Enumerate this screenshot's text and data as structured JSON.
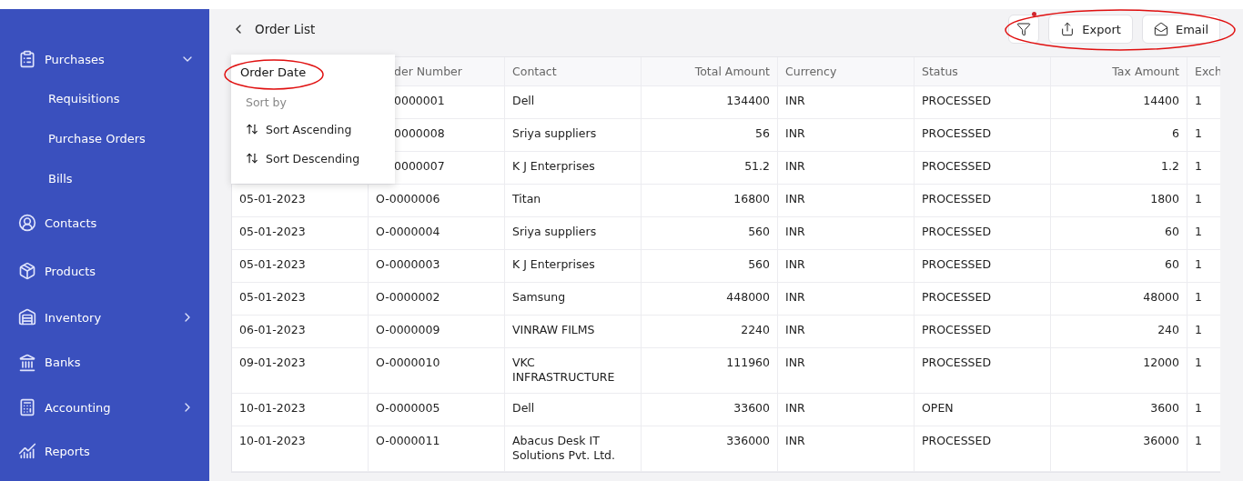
{
  "sidebar": {
    "items": [
      {
        "label": "Purchases",
        "expanded": true,
        "children": [
          {
            "label": "Requisitions"
          },
          {
            "label": "Purchase Orders"
          },
          {
            "label": "Bills"
          }
        ]
      },
      {
        "label": "Contacts"
      },
      {
        "label": "Products"
      },
      {
        "label": "Inventory",
        "expanded": false
      },
      {
        "label": "Banks"
      },
      {
        "label": "Accounting",
        "expanded": false
      },
      {
        "label": "Reports"
      }
    ]
  },
  "header": {
    "title": "Order List",
    "filter": {
      "indicator": true
    },
    "buttons": [
      {
        "label": "Export"
      },
      {
        "label": "Email"
      }
    ]
  },
  "table": {
    "columns": [
      null,
      "der Number",
      "Contact",
      "Total Amount",
      "Currency",
      "Status",
      "Tax Amount",
      "Exch"
    ],
    "rows": [
      [
        null,
        "0000001",
        "Dell",
        "134400",
        "INR",
        "PROCESSED",
        "14400",
        "1"
      ],
      [
        null,
        "0000008",
        "Sriya suppliers",
        "56",
        "INR",
        "PROCESSED",
        "6",
        "1"
      ],
      [
        null,
        "0000007",
        "K J Enterprises",
        "51.2",
        "INR",
        "PROCESSED",
        "1.2",
        "1"
      ],
      [
        "05-01-2023",
        "O-0000006",
        "Titan",
        "16800",
        "INR",
        "PROCESSED",
        "1800",
        "1"
      ],
      [
        "05-01-2023",
        "O-0000004",
        "Sriya suppliers",
        "560",
        "INR",
        "PROCESSED",
        "60",
        "1"
      ],
      [
        "05-01-2023",
        "O-0000003",
        "K J Enterprises",
        "560",
        "INR",
        "PROCESSED",
        "60",
        "1"
      ],
      [
        "05-01-2023",
        "O-0000002",
        "Samsung",
        "448000",
        "INR",
        "PROCESSED",
        "48000",
        "1"
      ],
      [
        "06-01-2023",
        "O-0000009",
        "VINRAW FILMS",
        "2240",
        "INR",
        "PROCESSED",
        "240",
        "1"
      ],
      [
        "09-01-2023",
        "O-0000010",
        "VKC INFRASTRUCTURE",
        "111960",
        "INR",
        "PROCESSED",
        "12000",
        "1"
      ],
      [
        "10-01-2023",
        "O-0000005",
        "Dell",
        "33600",
        "INR",
        "OPEN",
        "3600",
        "1"
      ],
      [
        "10-01-2023",
        "O-0000011",
        "Abacus Desk IT Solutions Pvt. Ltd.",
        "336000",
        "INR",
        "PROCESSED",
        "36000",
        "1"
      ]
    ]
  },
  "column_menu": {
    "field": "Order Date",
    "section": "Sort by",
    "items": [
      {
        "label": "Sort Ascending"
      },
      {
        "label": "Sort Descending"
      }
    ]
  }
}
